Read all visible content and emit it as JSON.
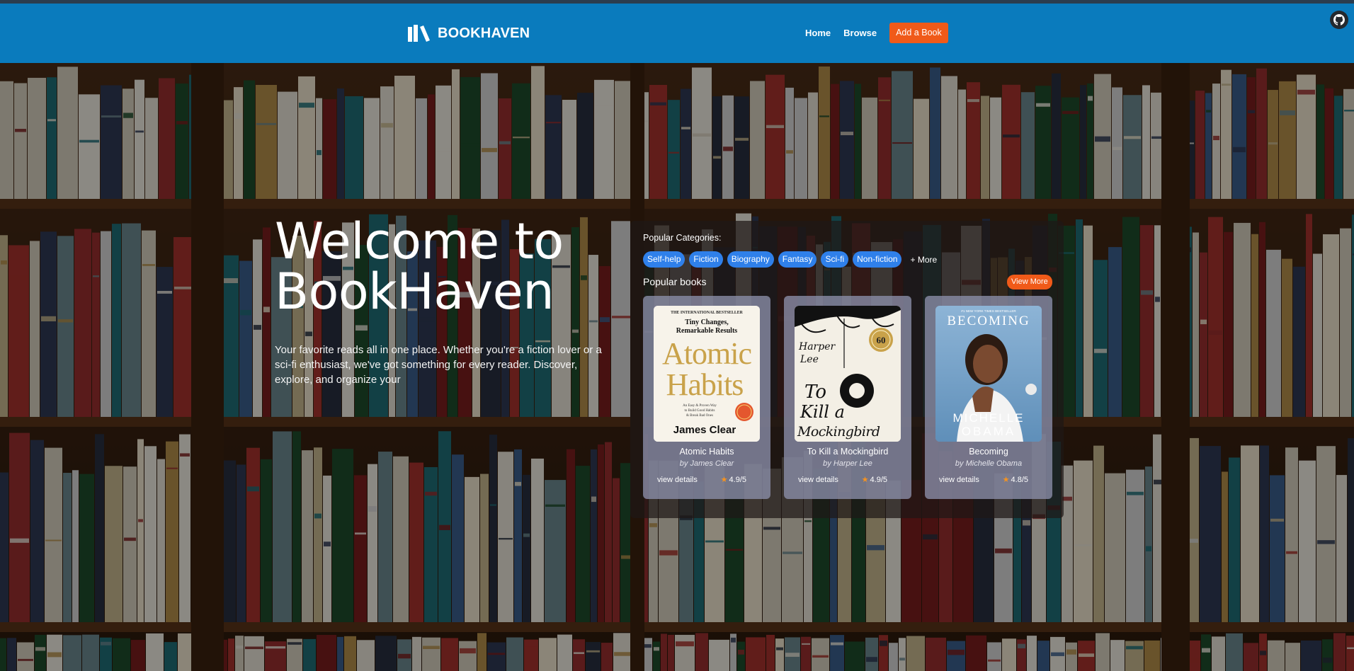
{
  "nav": {
    "brand": "BOOKHAVEN",
    "links": [
      "Home",
      "Browse"
    ],
    "cta": "Add a Book"
  },
  "hero": {
    "title_line1": "Welcome to",
    "title_line2": "BookHaven",
    "subtitle": "Your favorite reads all in one place. Whether you're a fiction lover or a sci-fi enthusiast, we've got something for every reader. Discover, explore, and organize your"
  },
  "categories": {
    "label": "Popular Categories:",
    "items": [
      "Self-help",
      "Fiction",
      "Biography",
      "Fantasy",
      "Sci-fi",
      "Non-fiction"
    ],
    "more": "+ More"
  },
  "books": {
    "label": "Popular books",
    "view_more": "View More",
    "details_label": "view details",
    "items": [
      {
        "title": "Atomic Habits",
        "author": "by James Clear",
        "rating": "4.9/5",
        "cover": {
          "top": "THE INTERNATIONAL BESTSELLER",
          "tag1": "Tiny Changes,",
          "tag2": "Remarkable Results",
          "t1": "Atomic",
          "t2": "Habits",
          "small1": "An Easy & Proven Way",
          "small2": "to Build Good Habits",
          "small3": "& Break Bad Ones",
          "name": "James Clear"
        }
      },
      {
        "title": "To Kill a Mockingbird",
        "author": "by Harper Lee",
        "rating": "4.9/5",
        "cover": {
          "a1": "Harper",
          "a2": "Lee",
          "t1": "To",
          "t2": "Kill a",
          "t3": "Mockingbird",
          "badge": "60"
        }
      },
      {
        "title": "Becoming",
        "author": "by Michelle Obama",
        "rating": "4.8/5",
        "cover": {
          "top": "#1 NEW YORK TIMES BESTSELLER",
          "t1": "BECOMING",
          "n1": "MICHELLE",
          "n2": "OBAMA"
        }
      }
    ]
  },
  "colors": {
    "navbar": "#0a7bbd",
    "accent": "#f05a19",
    "chip": "#2f80ea",
    "star": "#f7931e"
  },
  "icons": {
    "brand": "books-logo-icon",
    "github": "github-icon",
    "rating": "star-icon"
  }
}
